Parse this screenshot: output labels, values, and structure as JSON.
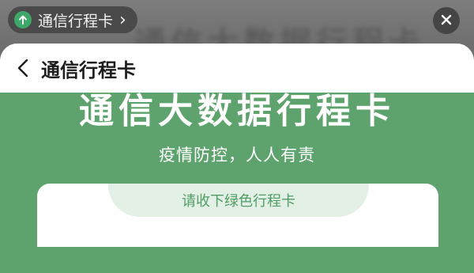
{
  "mini_program_bar": {
    "title": "通信行程卡",
    "chevron": "›",
    "logo_icon": "up-arrow-circle-icon"
  },
  "close_icon": "close-icon",
  "background_text": "通信大数据行程卡",
  "sheet": {
    "back_icon": "chevron-left-icon",
    "title": "通信行程卡"
  },
  "hero": {
    "title": "通信大数据行程卡",
    "subtitle": "疫情防控，人人有责"
  },
  "card": {
    "label": "请收下绿色行程卡"
  },
  "colors": {
    "brand_green": "#5ea36d",
    "label_green": "#4f9c64",
    "label_bg": "#e3f0e5"
  }
}
